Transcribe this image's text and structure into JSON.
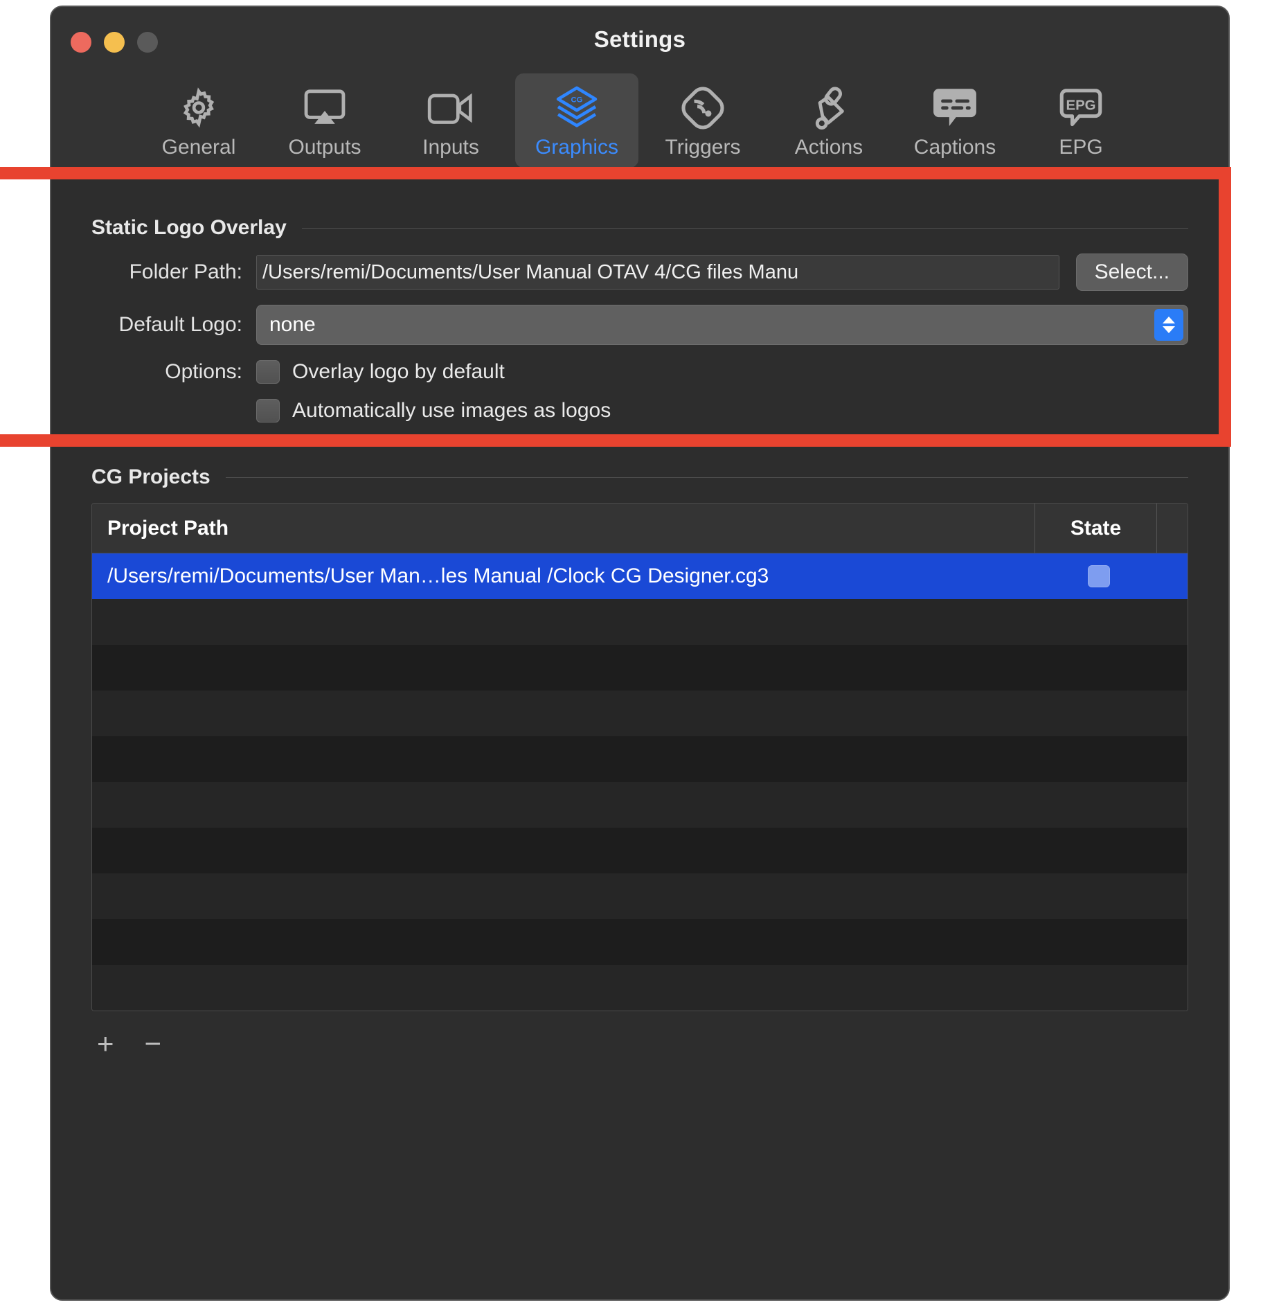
{
  "window": {
    "title": "Settings",
    "traffic_lights": [
      "close",
      "minimize",
      "zoom"
    ]
  },
  "toolbar": {
    "items": [
      {
        "label": "General",
        "icon": "gear-icon",
        "selected": false
      },
      {
        "label": "Outputs",
        "icon": "airplay-icon",
        "selected": false
      },
      {
        "label": "Inputs",
        "icon": "video-camera-icon",
        "selected": false
      },
      {
        "label": "Graphics",
        "icon": "cg-layers-icon",
        "selected": true
      },
      {
        "label": "Triggers",
        "icon": "signal-tag-icon",
        "selected": false
      },
      {
        "label": "Actions",
        "icon": "paint-roller-icon",
        "selected": false
      },
      {
        "label": "Captions",
        "icon": "caption-bubble-icon",
        "selected": false
      },
      {
        "label": "EPG",
        "icon": "epg-bubble-icon",
        "selected": false
      }
    ]
  },
  "static_logo_overlay": {
    "section_title": "Static Logo Overlay",
    "folder_path": {
      "label": "Folder Path:",
      "value": "/Users/remi/Documents/User Manual OTAV 4/CG files Manu",
      "button_label": "Select..."
    },
    "default_logo": {
      "label": "Default Logo:",
      "value": "none"
    },
    "options": {
      "label": "Options:",
      "items": [
        {
          "text": "Overlay logo by default",
          "checked": false
        },
        {
          "text": "Automatically use images as logos",
          "checked": false
        }
      ]
    }
  },
  "cg_projects": {
    "section_title": "CG Projects",
    "columns": [
      "Project Path",
      "State"
    ],
    "rows": [
      {
        "path": "/Users/remi/Documents/User Man…les Manual /Clock CG Designer.cg3",
        "state_checked": false,
        "selected": true
      },
      {
        "path": "",
        "state_checked": false,
        "selected": false
      },
      {
        "path": "",
        "state_checked": false,
        "selected": false
      },
      {
        "path": "",
        "state_checked": false,
        "selected": false
      },
      {
        "path": "",
        "state_checked": false,
        "selected": false
      },
      {
        "path": "",
        "state_checked": false,
        "selected": false
      },
      {
        "path": "",
        "state_checked": false,
        "selected": false
      },
      {
        "path": "",
        "state_checked": false,
        "selected": false
      },
      {
        "path": "",
        "state_checked": false,
        "selected": false
      },
      {
        "path": "",
        "state_checked": false,
        "selected": false
      }
    ],
    "add_label": "+",
    "remove_label": "−"
  },
  "annotation": {
    "highlight_color": "#e8432f"
  },
  "colors": {
    "accent_blue": "#3b8cff",
    "selection_blue": "#1a49d6",
    "window_bg": "#2d2d2d",
    "toolbar_bg": "#333333"
  }
}
